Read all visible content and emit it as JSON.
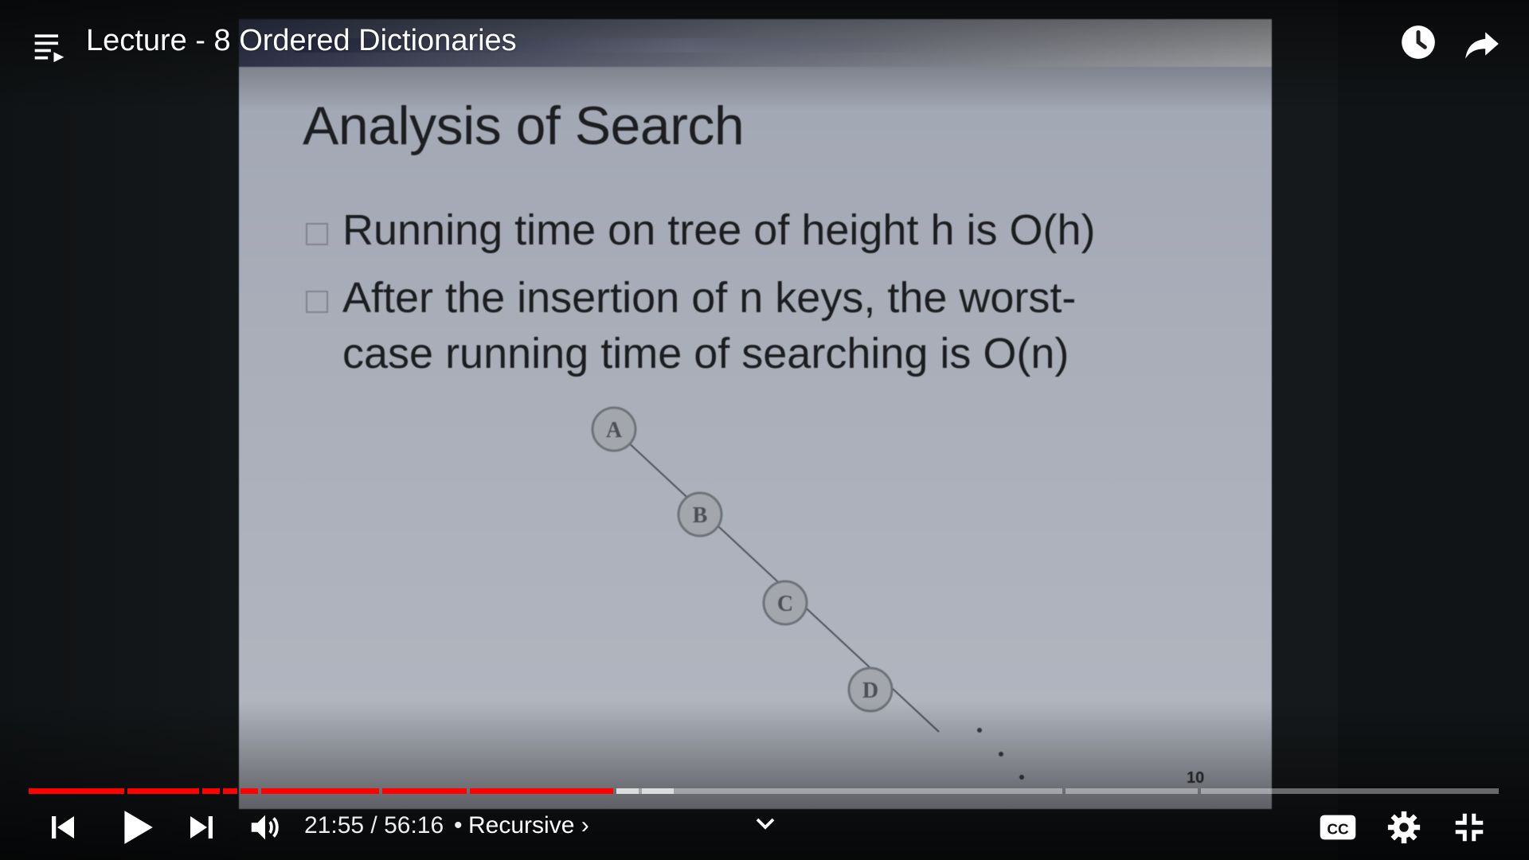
{
  "header": {
    "title": "Lecture - 8 Ordered Dictionaries"
  },
  "slide": {
    "title": "Analysis of Search",
    "bullet1": "Running time on tree of height h is O(h)",
    "bullet2_line1": "After the insertion of n keys, the worst-",
    "bullet2_line2": "case running time of searching is O(n)",
    "nodes": [
      "A",
      "B",
      "C",
      "D"
    ],
    "page_number": "10"
  },
  "controls": {
    "current_time": "21:55",
    "duration": "56:16",
    "time_display": "21:55 / 56:16",
    "chapter_separator": "•",
    "chapter": "Recursive ›",
    "progress_fraction": 0.39
  },
  "icons": {
    "playlist": "playlist-icon",
    "watch_later": "clock-icon",
    "share": "share-icon",
    "previous": "skip-previous-icon",
    "play": "play-icon",
    "next": "skip-next-icon",
    "volume": "volume-icon",
    "expand": "chevron-down-icon",
    "captions": "cc-icon",
    "settings": "gear-icon",
    "fullscreen_exit": "exit-fullscreen-icon"
  },
  "colors": {
    "progress_played": "#ff0000",
    "slide_background": "#a9aeb9"
  }
}
